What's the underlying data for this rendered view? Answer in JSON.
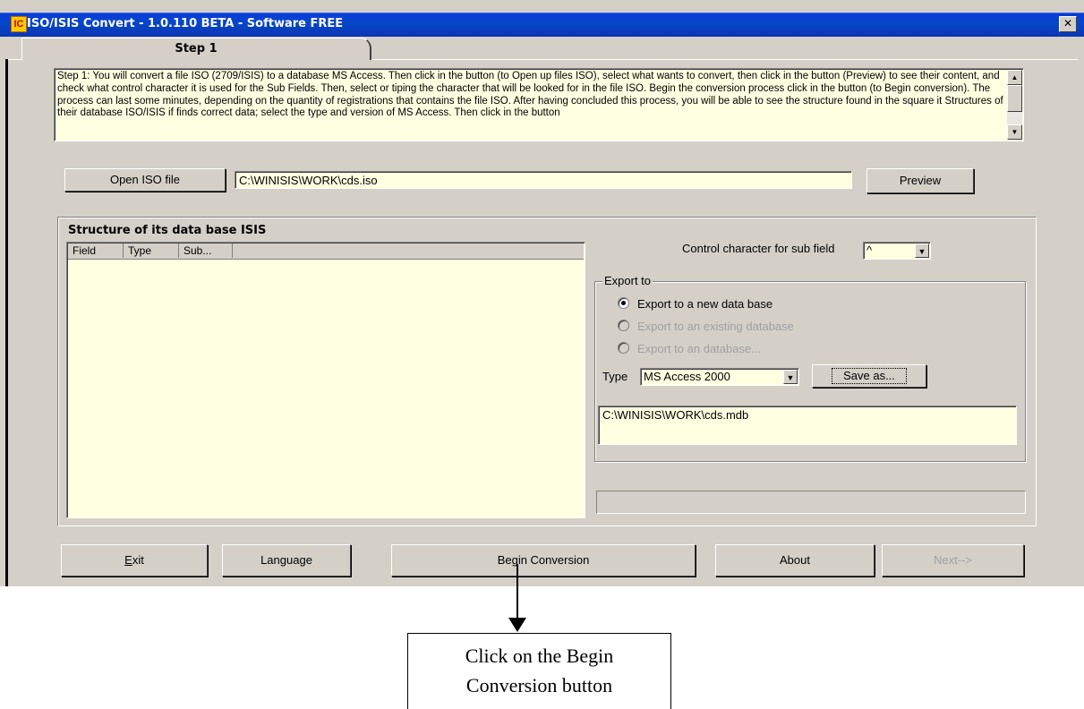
{
  "window": {
    "title": "ISO/ISIS Convert - 1.0.110 BETA - Software FREE",
    "icon_text": "IC",
    "close_symbol": "✕"
  },
  "tabs": [
    {
      "label": "Step 1",
      "active": true
    }
  ],
  "instructions": "Step 1: You will convert a file ISO (2709/ISIS) to a database MS Access. Then click in the button (to Open up files ISO), select what wants to convert, then  click in the button (Preview) to see their content, and check what control character it is used for the Sub Fields. Then, select or tiping the character that will be looked for in the file ISO. Begin the conversion process click in the button (to Begin conversion). The process can last some minutes, depending on the quantity of registrations that contains the file ISO. After having concluded this process, you will be able to see the structure found in the square it Structures of their database ISO/ISIS if finds correct data; select the type and version of MS Access. Then click in the button",
  "open_iso": {
    "button_label": "Open ISO file",
    "path": "C:\\WINISIS\\WORK\\cds.iso"
  },
  "preview_label": "Preview",
  "structure": {
    "title": "Structure of its data base ISIS",
    "columns": [
      "Field",
      "Type",
      "Sub..."
    ]
  },
  "control_char": {
    "label": "Control character for sub field",
    "value": "^"
  },
  "export": {
    "legend": "Export to",
    "options": [
      {
        "label": "Export to a new data base",
        "selected": true,
        "enabled": true
      },
      {
        "label": "Export to an existing database",
        "selected": false,
        "enabled": false
      },
      {
        "label": "Export to an database...",
        "selected": false,
        "enabled": false
      }
    ],
    "type_label": "Type",
    "type_value": "MS Access 2000",
    "save_as_label": "Save as...",
    "output_path": "C:\\WINISIS\\WORK\\cds.mdb"
  },
  "buttons": {
    "exit": "Exit",
    "language": "Language",
    "begin": "Begin Conversion",
    "about": "About",
    "next": "Next-->"
  },
  "annotation": {
    "line1": "Click on the Begin",
    "line2": "Conversion button"
  },
  "colors": {
    "title_bar": "#0a3cd8",
    "window_bg": "#d4d0c8",
    "field_bg": "#ffffe1"
  }
}
